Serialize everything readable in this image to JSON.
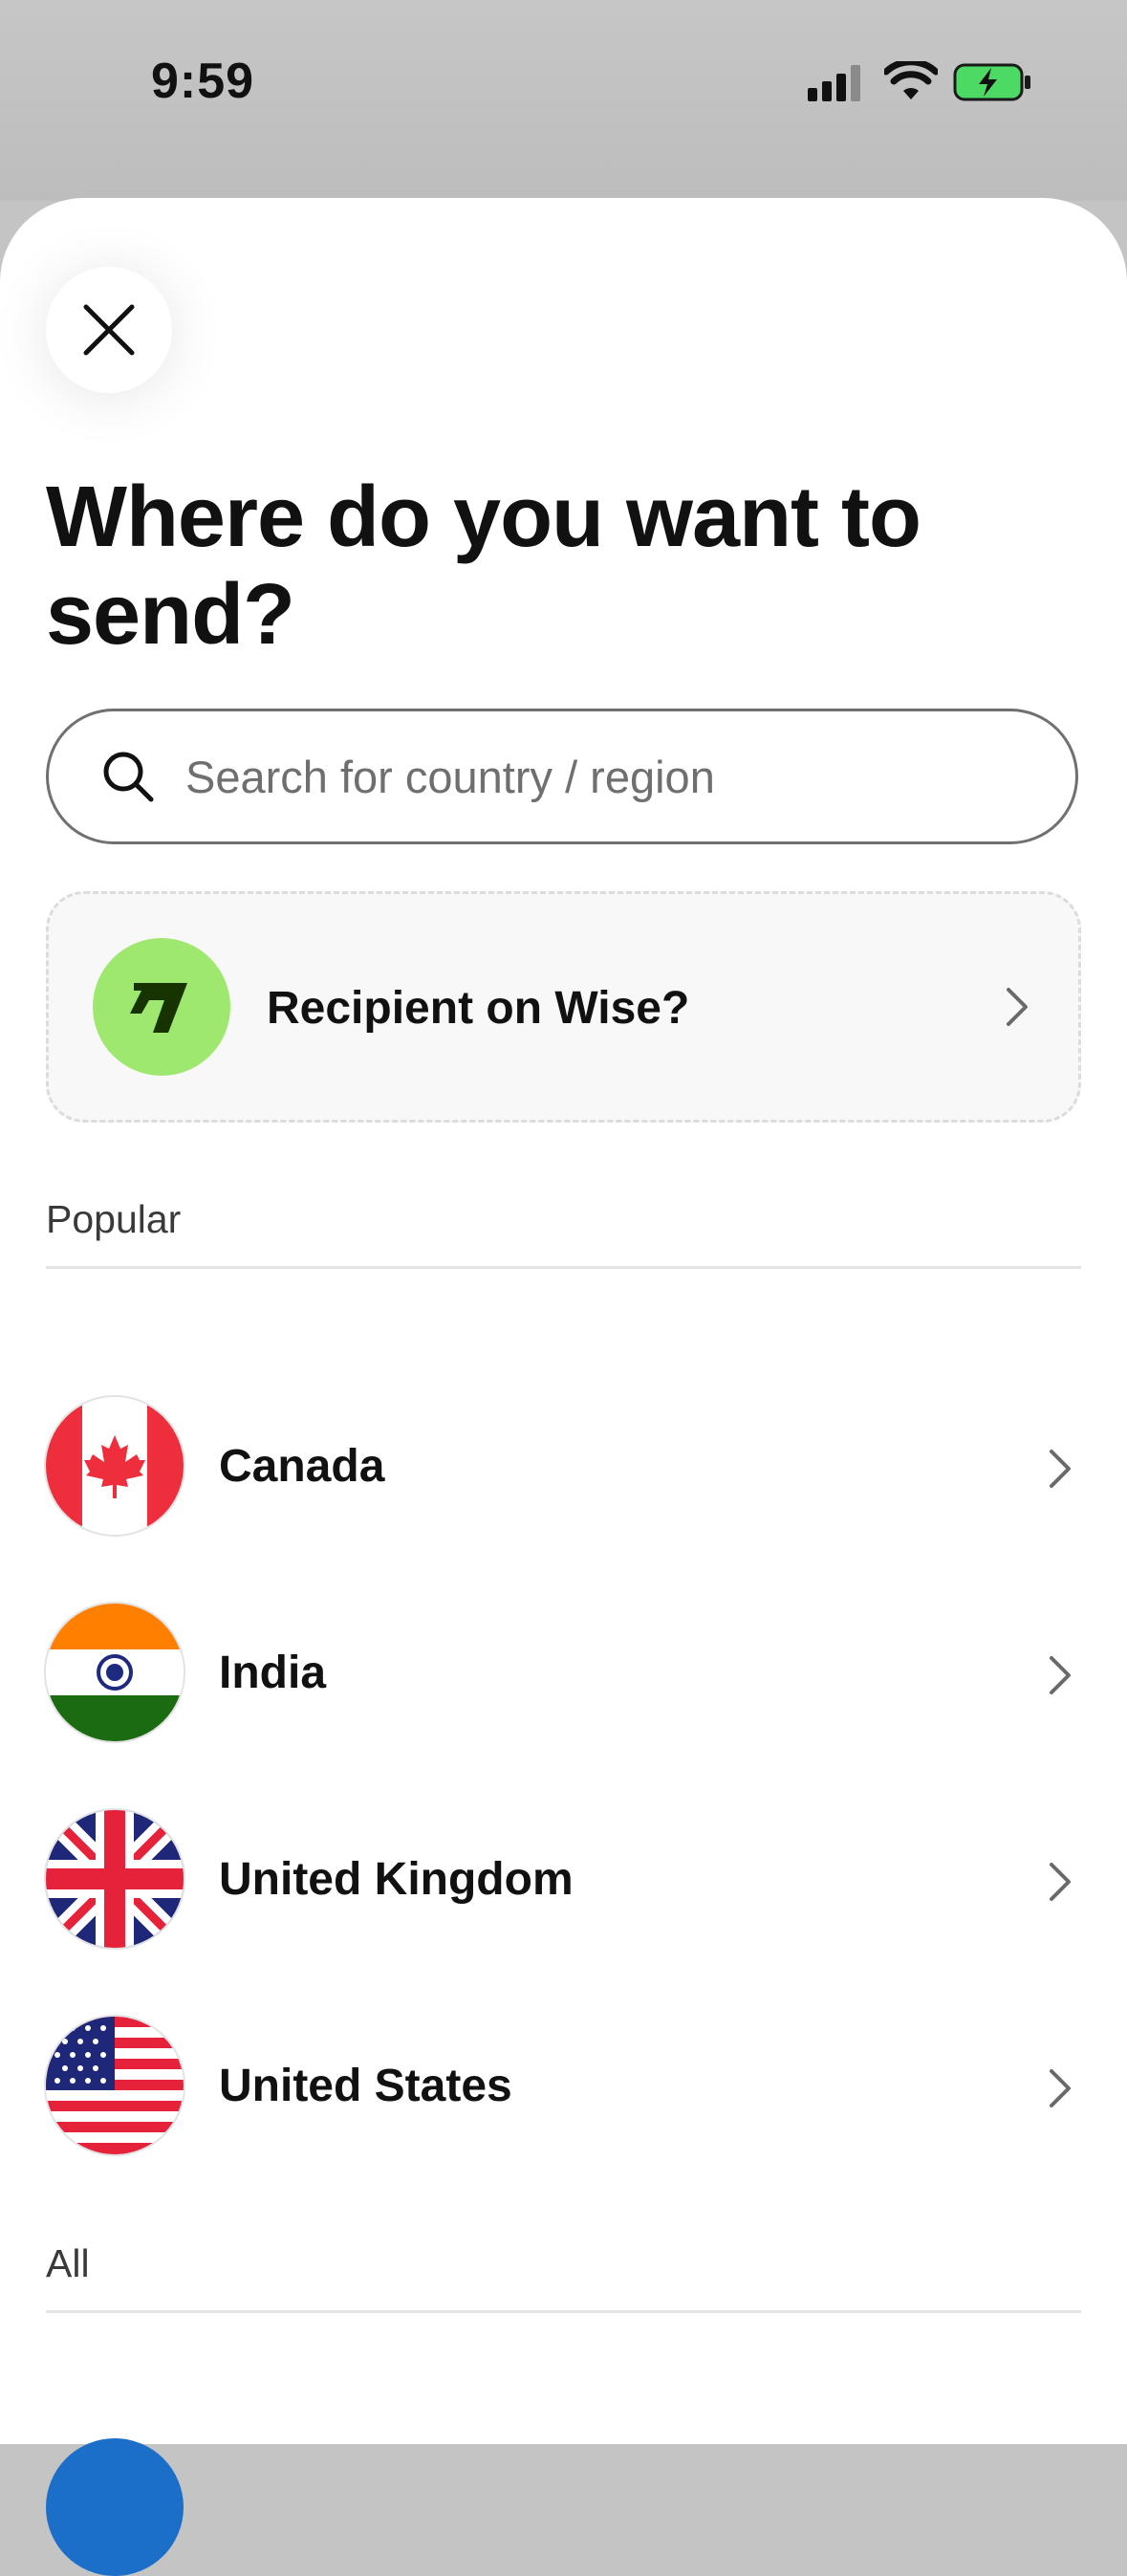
{
  "status_bar": {
    "time": "9:59"
  },
  "close_label": "Close",
  "title": "Where do you want to send?",
  "search": {
    "placeholder": "Search for country / region"
  },
  "wise_card": {
    "label": "Recipient on Wise?"
  },
  "sections": {
    "popular": "Popular",
    "all": "All"
  },
  "popular_countries": [
    {
      "name": "Canada",
      "flag": "canada-flag-icon"
    },
    {
      "name": "India",
      "flag": "india-flag-icon"
    },
    {
      "name": "United Kingdom",
      "flag": "uk-flag-icon"
    },
    {
      "name": "United States",
      "flag": "us-flag-icon"
    }
  ],
  "colors": {
    "wise_green": "#9fe870",
    "text": "#111111",
    "battery_green": "#4cd964"
  }
}
